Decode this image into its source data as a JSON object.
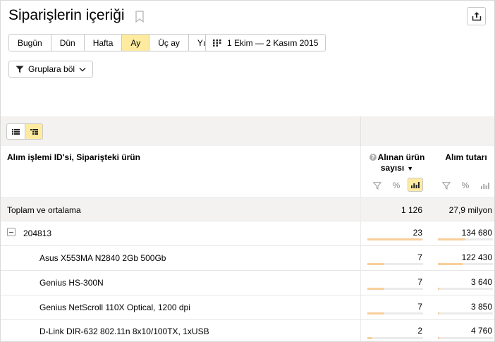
{
  "header": {
    "title": "Siparişlerin içeriği"
  },
  "periods": [
    {
      "label": "Bugün",
      "active": false
    },
    {
      "label": "Dün",
      "active": false
    },
    {
      "label": "Hafta",
      "active": false
    },
    {
      "label": "Ay",
      "active": true
    },
    {
      "label": "Üç ay",
      "active": false
    },
    {
      "label": "Yıl",
      "active": false
    }
  ],
  "date_range": "1 Ekim — 2 Kasım 2015",
  "group_button": "Gruplara böl",
  "table": {
    "dimension_header": "Alım işlemi ID'si, Siparişteki ürün",
    "metric1_header": "Alınan ürün sayısı",
    "metric2_header": "Alım tutarı",
    "total": {
      "label": "Toplam ve ortalama",
      "m1": "1 126",
      "m2": "27,9 milyon"
    },
    "rows": [
      {
        "label": "204813",
        "m1": "23",
        "m2": "134 680",
        "bar1": 0.98,
        "bar2": 0.5,
        "level": 0
      },
      {
        "label": "Asus X553MA N2840 2Gb 500Gb",
        "m1": "7",
        "m2": "122 430",
        "bar1": 0.3,
        "bar2": 0.45,
        "level": 1
      },
      {
        "label": "Genius HS-300N",
        "m1": "7",
        "m2": "3 640",
        "bar1": 0.3,
        "bar2": 0.02,
        "level": 1
      },
      {
        "label": "Genius NetScroll 110X Optical, 1200 dpi",
        "m1": "7",
        "m2": "3 850",
        "bar1": 0.3,
        "bar2": 0.02,
        "level": 1
      },
      {
        "label": "D-Link DIR-632 802.11n 8x10/100TX, 1xUSB",
        "m1": "2",
        "m2": "4 760",
        "bar1": 0.09,
        "bar2": 0.03,
        "level": 1
      }
    ]
  },
  "colors": {
    "accent": "#ffeba0",
    "bar": "#f8cf9b",
    "toolbar_bg": "#f3f2f0"
  }
}
